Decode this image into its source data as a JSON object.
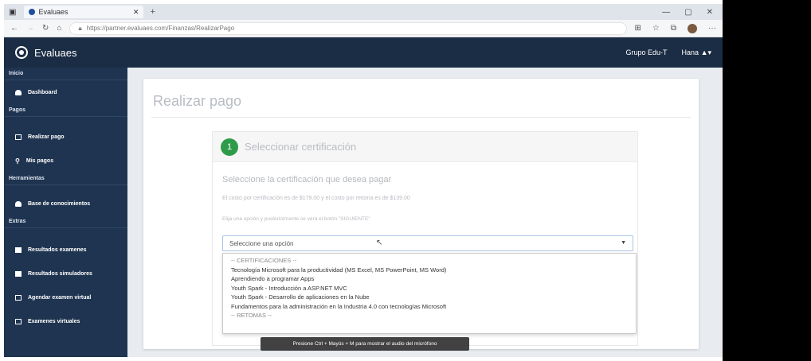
{
  "browser": {
    "tab_title": "Evaluaes",
    "url": "https://partner.evaluaes.com/Finanzas/RealizarPago",
    "new_tab": "+",
    "window_controls": [
      "—",
      "▢",
      "✕"
    ]
  },
  "navbar": {
    "brand": "Evaluaes",
    "org": "Grupo Edu-T",
    "user": "Hana ▲▾"
  },
  "sidebar": {
    "sections": [
      {
        "header": "Inicio",
        "items": [
          {
            "label": "Dashboard",
            "icon": "home-icon"
          }
        ]
      },
      {
        "header": "Pagos",
        "items": [
          {
            "label": "Realizar pago",
            "icon": "card-icon"
          },
          {
            "label": "Mis pagos",
            "icon": "search-icon"
          }
        ]
      },
      {
        "header": "Herramientas",
        "items": [
          {
            "label": "Base de conocimientos",
            "icon": "home-icon"
          }
        ]
      },
      {
        "header": "Extras",
        "items": [
          {
            "label": "Resultados examenes",
            "icon": "folder-icon"
          },
          {
            "label": "Resultados simuladores",
            "icon": "folder-icon"
          },
          {
            "label": "Agendar examen virtual",
            "icon": "calendar-icon"
          },
          {
            "label": "Examenes virtuales",
            "icon": "calendar-icon"
          }
        ]
      }
    ]
  },
  "main": {
    "page_title": "Realizar pago",
    "step_number": "1",
    "step_title": "Seleccionar certificación",
    "subtitle": "Seleccione la certificación que desea pagar",
    "help_line_1": "El costo por certificación es de $179.00 y el costo por retoma es de $139.00",
    "help_line_2": "Elija una opción y posteriormente se verá el botón \"SIGUIENTE\"",
    "select_value": "Seleccione una opción",
    "options": [
      "-- CERTIFICACIONES --",
      "Tecnología Microsoft para la productividad (MS Excel, MS PowerPoint, MS Word)",
      "Aprendiendo a programar Apps",
      "Youth Spark - Introducción a ASP.NET MVC",
      "Youth Spark - Desarrollo de aplicaciones en la Nube",
      "Fundamentos para la administración en la Industria 4.0 con tecnologías Microsoft",
      "-- RETOMAS --"
    ]
  },
  "tooltip": "Presione Ctrl + Mayús + M para mostrar el audio del micrófono"
}
